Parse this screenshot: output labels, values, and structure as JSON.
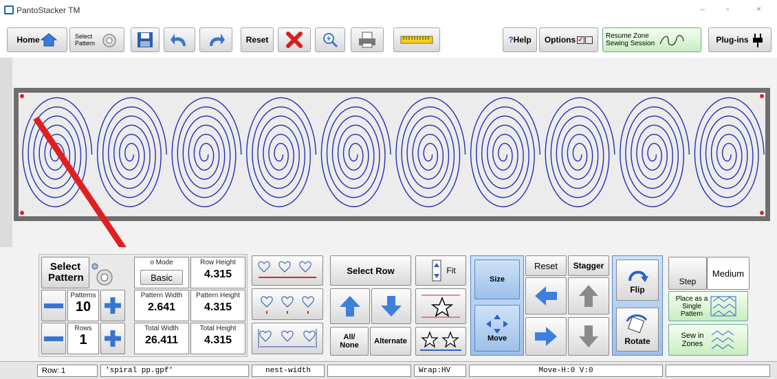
{
  "window": {
    "title": "PantoStacker TM",
    "minimize": "–",
    "maximize": "▫",
    "close": "×"
  },
  "toolbar": {
    "home": "Home",
    "select_pattern": "Select Pattern",
    "reset": "Reset",
    "help": "Help",
    "options": "Options",
    "resume_line1": "Resume Zone",
    "resume_line2": "Sewing Session",
    "plugins": "Plug-ins"
  },
  "controls": {
    "select_pattern": "Select Pattern",
    "mode_label": "o Mode",
    "mode_value": "Basic",
    "row_height_label": "Row Height",
    "row_height": "4.315",
    "patterns_label": "Patterns",
    "patterns": "10",
    "pattern_width_label": "Pattern Width",
    "pattern_width": "2.641",
    "pattern_height_label": "Pattern Height",
    "pattern_height": "4.315",
    "rows_label": "Rows",
    "rows": "1",
    "total_width_label": "Total Width",
    "total_width": "26.411",
    "total_height_label": "Total Height",
    "total_height": "4.315",
    "select_row": "Select Row",
    "all_none": "All/ None",
    "alternate": "Alternate",
    "fit": "Fit",
    "size": "Size",
    "move": "Move",
    "reset": "Reset",
    "stagger": "Stagger",
    "flip": "Flip",
    "rotate": "Rotate",
    "step": "Step",
    "medium": "Medium",
    "place_single": "Place as a Single Pattern",
    "sew_in_zones": "Sew in Zones"
  },
  "status": {
    "row": "Row: 1",
    "file": "'spiral pp.gpf'",
    "mode": "nest-width",
    "wrap": "Wrap:HV",
    "move": "Move-H:0 V:0"
  },
  "colors": {
    "pattern": "#1f2fb0",
    "arrow": "#e02020",
    "accent": "#4a84d8"
  }
}
